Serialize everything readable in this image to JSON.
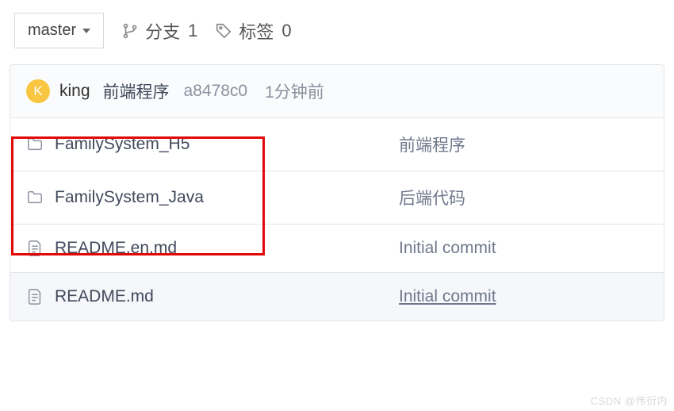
{
  "toolbar": {
    "branch_label": "master",
    "branches_label": "分支",
    "branches_count": "1",
    "tags_label": "标签",
    "tags_count": "0"
  },
  "commit": {
    "avatar_initial": "K",
    "committer": "king",
    "message": "前端程序",
    "hash": "a8478c0",
    "time": "1分钟前"
  },
  "files": [
    {
      "name": "FamilySystem_H5",
      "type": "folder",
      "msg": "前端程序",
      "underline": false
    },
    {
      "name": "FamilySystem_Java",
      "type": "folder",
      "msg": "后端代码",
      "underline": false
    },
    {
      "name": "README.en.md",
      "type": "file",
      "msg": "Initial commit",
      "underline": false
    },
    {
      "name": "README.md",
      "type": "file",
      "msg": "Initial commit",
      "underline": true
    }
  ],
  "watermark": "CSDN @伟衍内"
}
